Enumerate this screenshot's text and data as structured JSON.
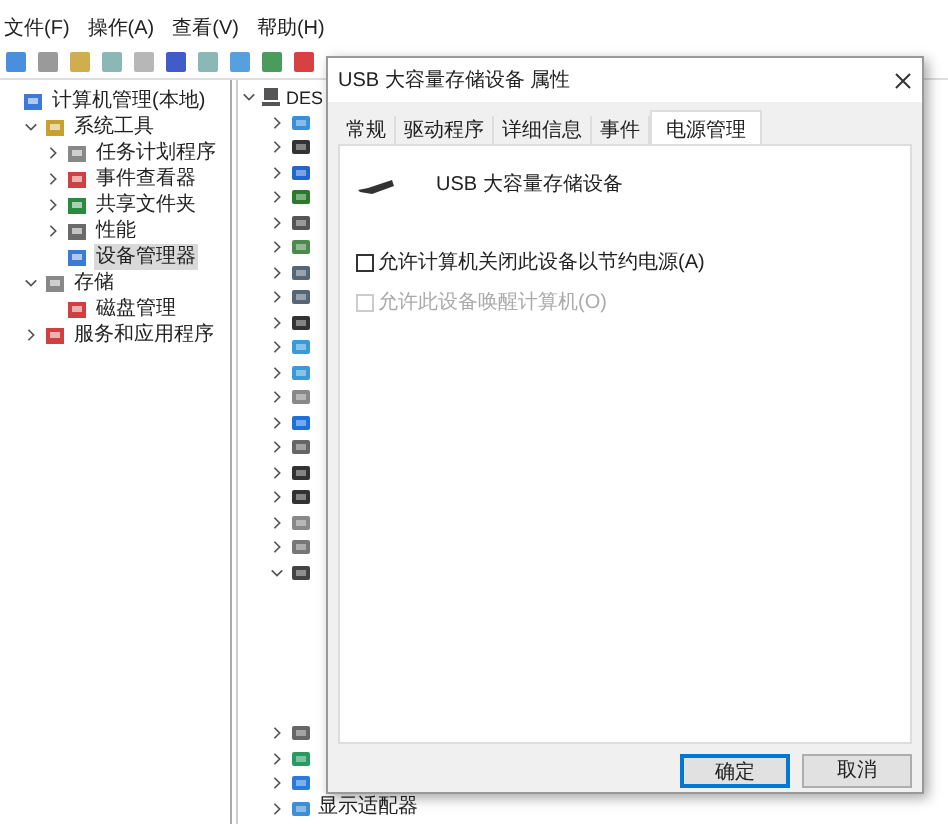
{
  "menu": [
    "文件(F)",
    "操作(A)",
    "查看(V)",
    "帮助(H)"
  ],
  "tree": [
    {
      "label": "计算机管理(本地)",
      "children": [
        {
          "label": "系统工具",
          "expanded": true,
          "children": [
            {
              "label": "任务计划程序",
              "expanded": false,
              "selected": false
            },
            {
              "label": "事件查看器",
              "expanded": false,
              "selected": false
            },
            {
              "label": "共享文件夹",
              "expanded": false,
              "selected": false
            },
            {
              "label": "性能",
              "expanded": false,
              "selected": false
            },
            {
              "label": "设备管理器",
              "selected": true
            }
          ]
        },
        {
          "label": "存储",
          "expanded": true,
          "children": [
            {
              "label": "磁盘管理",
              "selected": false
            }
          ]
        },
        {
          "label": "服务和应用程序",
          "expanded": false
        }
      ]
    }
  ],
  "devices": {
    "root": "DES",
    "rows": [
      {
        "expanded": false
      },
      {
        "expanded": false
      },
      {
        "expanded": false
      },
      {
        "expanded": false
      },
      {
        "expanded": false
      },
      {
        "expanded": false
      },
      {
        "expanded": false
      },
      {
        "expanded": false
      },
      {
        "expanded": false
      },
      {
        "expanded": false
      },
      {
        "expanded": false
      },
      {
        "expanded": false
      },
      {
        "expanded": false
      },
      {
        "expanded": false
      },
      {
        "expanded": false
      },
      {
        "expanded": false
      },
      {
        "expanded": false
      },
      {
        "expanded": false
      },
      {
        "expanded": true
      },
      {
        "expanded": false
      },
      {
        "expanded": false
      },
      {
        "expanded": false
      },
      {
        "expanded": false,
        "label": "显示适配器"
      }
    ]
  },
  "dialog": {
    "title": "USB 大容量存储设备 属性",
    "tabs": [
      {
        "label": "常规",
        "selected": false
      },
      {
        "label": "驱动程序",
        "selected": false
      },
      {
        "label": "详细信息",
        "selected": false
      },
      {
        "label": "事件",
        "selected": false
      },
      {
        "label": "电源管理",
        "selected": true
      }
    ],
    "device_name": "USB 大容量存储设备",
    "options": [
      {
        "label": "允许计算机关闭此设备以节约电源(A)",
        "checked": false,
        "disabled": false
      },
      {
        "label": "允许此设备唤醒计算机(O)",
        "checked": false,
        "disabled": true
      }
    ],
    "buttons": [
      {
        "label": "确定",
        "default": true
      },
      {
        "label": "取消",
        "default": false
      }
    ]
  }
}
